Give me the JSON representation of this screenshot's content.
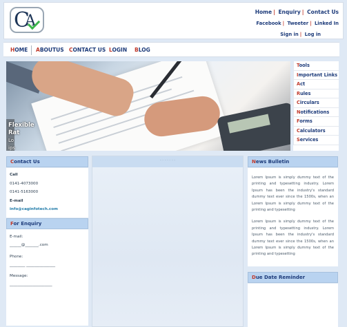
{
  "header": {
    "logo_text": "CA",
    "links_row1": [
      "Home",
      "Enquiry",
      "Contact Us"
    ],
    "links_row2": [
      "Facebook",
      "Tweeter",
      "Linked In"
    ],
    "links_row3": [
      "Sign in",
      "Log in"
    ]
  },
  "nav": {
    "items": [
      "HOME",
      "ABOUTUS",
      "CONTACT US",
      "LOGIN",
      "BLOG"
    ]
  },
  "banner": {
    "caption_title": "Flexible",
    "caption_line2": "Rat",
    "caption_line3": "Lo",
    "caption_line4": "ips"
  },
  "side_menu": {
    "items": [
      "Tools",
      "Important Links",
      "Act",
      "Rules",
      "Circulars",
      "Notifications",
      "Forms",
      "Calculators",
      "Services"
    ]
  },
  "contact": {
    "heading": "Contact Us",
    "call_label": "Call",
    "phone1": "0141-4073000",
    "phone2": "0141-5163000",
    "email_label": "E-mail",
    "email": "info@caginfotech.com"
  },
  "enquiry": {
    "heading": "For Enquiry",
    "email_label": "E-mail:",
    "email_pattern": "______@_______.com",
    "phone_label": "Phone:",
    "phone_pattern": "________  _______________",
    "message_label": "Message:",
    "message_pattern": "______________________"
  },
  "center": {
    "top_label": "- - - - -   - -"
  },
  "news": {
    "heading": "News Bulletin",
    "para1": "Lorem Ipsum is simply dummy text of the printing and typesetting industry. Lorem Ipsum has been the industry's standard dummy text ever since the 1500s, when an Lorem Ipsum is simply dummy text of the printing and typesetting",
    "para2": "Lorem Ipsum is simply dummy text of the printing and typesetting industry. Lorem Ipsum has been the industry's standard dummy text ever since the 1500s, when an Lorem Ipsum is simply dummy text of the printing and typesetting"
  },
  "due": {
    "heading": "Due Date Reminder"
  },
  "colors": {
    "accent_red": "#c0392b",
    "nav_blue": "#1d3b7a",
    "panel_blue": "#b9d3f0",
    "logo_green": "#3bb54a"
  }
}
